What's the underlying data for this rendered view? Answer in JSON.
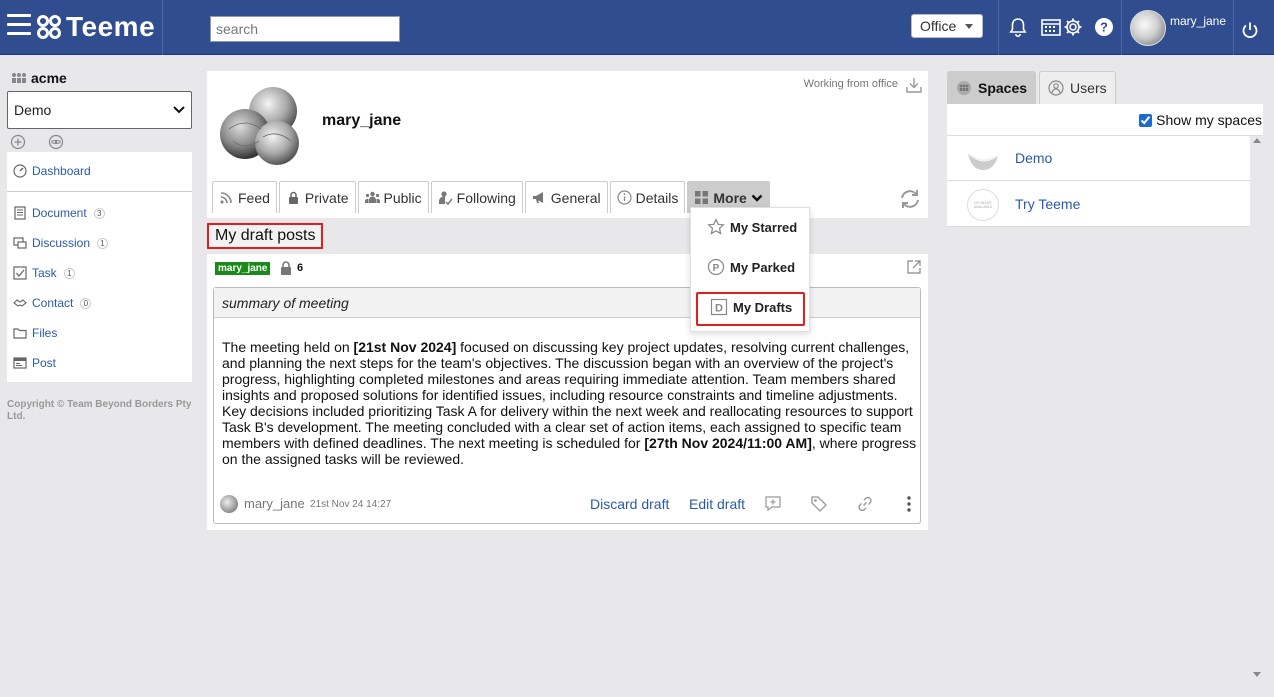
{
  "header": {
    "logo_text": "Teeme",
    "search_placeholder": "search",
    "location_select": "Office",
    "username": "mary_jane"
  },
  "sidebar": {
    "org": "acme",
    "space_select": "Demo",
    "items": [
      {
        "label": "Dashboard",
        "icon": "dashboard-icon",
        "count": ""
      },
      {
        "label": "Document",
        "icon": "document-icon",
        "count": "3"
      },
      {
        "label": "Discussion",
        "icon": "discussion-icon",
        "count": "1"
      },
      {
        "label": "Task",
        "icon": "task-icon",
        "count": "1"
      },
      {
        "label": "Contact",
        "icon": "contact-icon",
        "count": "0"
      },
      {
        "label": "Files",
        "icon": "folder-icon",
        "count": ""
      },
      {
        "label": "Post",
        "icon": "post-icon",
        "count": ""
      }
    ],
    "copyright": "Copyright © Team Beyond Borders Pty Ltd."
  },
  "profile": {
    "name": "mary_jane",
    "status": "Working from office",
    "tabs": [
      {
        "label": "Feed",
        "icon": "rss-icon"
      },
      {
        "label": "Private",
        "icon": "lock-icon"
      },
      {
        "label": "Public",
        "icon": "people-icon"
      },
      {
        "label": "Following",
        "icon": "follow-icon"
      },
      {
        "label": "General",
        "icon": "megaphone-icon"
      },
      {
        "label": "Details",
        "icon": "info-icon"
      },
      {
        "label": "More",
        "icon": "grid-icon"
      }
    ]
  },
  "more_menu": {
    "items": [
      {
        "label": "My Starred",
        "icon": "star-icon"
      },
      {
        "label": "My Parked",
        "icon": "parked-icon"
      },
      {
        "label": "My Drafts",
        "icon": "drafts-icon"
      }
    ]
  },
  "drafts": {
    "title": "My draft posts"
  },
  "post": {
    "user_tag": "mary_jane",
    "lock_count": "6",
    "subject": "summary of meeting",
    "body_1": "The meeting held on ",
    "date_1": "[21st Nov 2024]",
    "body_2": " focused on discussing key project updates, resolving current challenges, and planning the next steps for the team's objectives. The discussion began with an overview of the project's progress, highlighting completed milestones and areas requiring immediate attention. Team members shared insights and proposed solutions for identified issues, including resource constraints and timeline adjustments. Key decisions included prioritizing Task A for delivery within the next week and reallocating resources to support Task B's development. The meeting concluded with a clear set of action items, each assigned to specific team members with defined deadlines. The next meeting is scheduled for ",
    "date_2": "[27th Nov 2024/11:00 AM]",
    "body_3": ", where progress on the assigned tasks will be reviewed.",
    "author": "mary_jane",
    "timestamp": "21st Nov 24 14:27",
    "discard_label": "Discard draft",
    "edit_label": "Edit draft"
  },
  "right_panel": {
    "tabs": [
      {
        "label": "Spaces",
        "icon": "spaces-icon",
        "active": true
      },
      {
        "label": "Users",
        "icon": "users-icon",
        "active": false
      }
    ],
    "show_mine_label": "Show my spaces",
    "show_mine_checked": true,
    "spaces": [
      {
        "name": "Demo"
      },
      {
        "name": "Try Teeme",
        "thumb_text": "NO IMAGE AVAILABLE"
      }
    ]
  },
  "colors": {
    "topbar": "#2f4d8f",
    "link": "#2a5aa8",
    "highlight": "#e02020",
    "user_tag": "#1a8a1a"
  }
}
